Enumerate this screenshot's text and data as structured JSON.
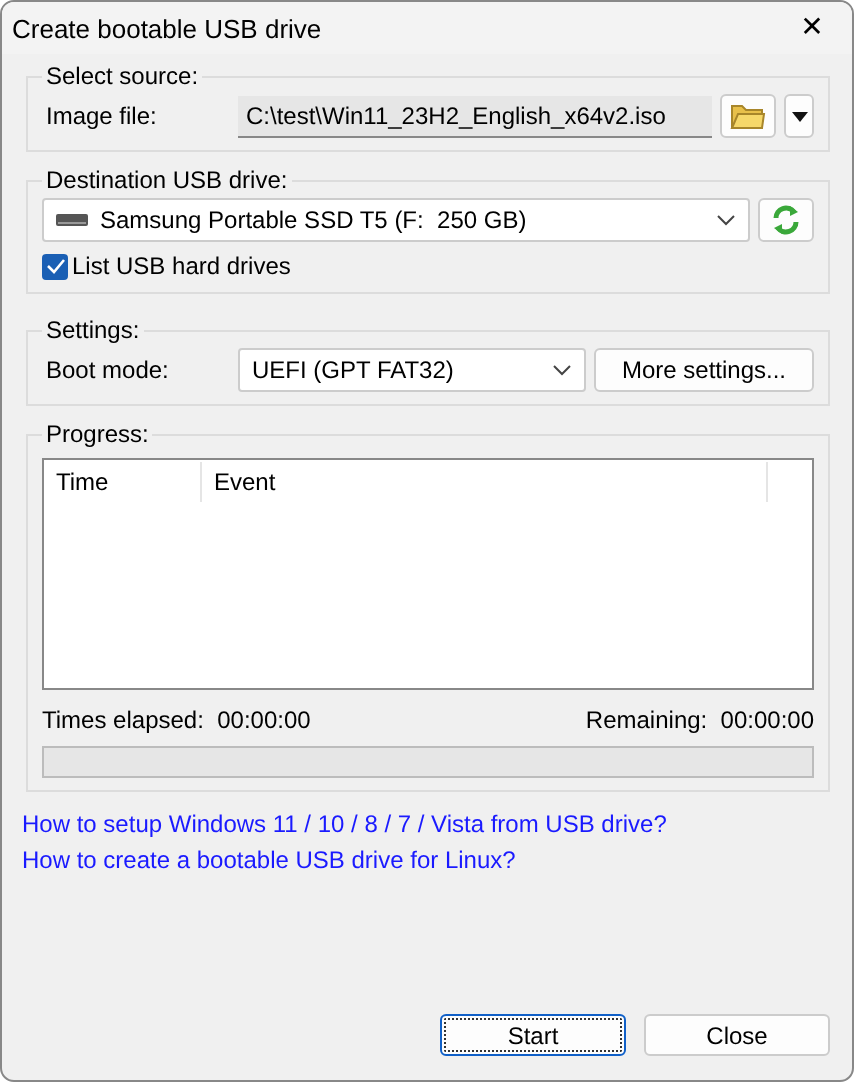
{
  "window": {
    "title": "Create bootable USB drive",
    "close": "✕"
  },
  "source": {
    "legend": "Select source:",
    "label": "Image file:",
    "value": "C:\\test\\Win11_23H2_English_x64v2.iso"
  },
  "destination": {
    "legend": "Destination USB drive:",
    "drive": "Samsung Portable SSD T5 (F:  250 GB)",
    "list_usb": {
      "label": "List USB hard drives",
      "checked": true
    }
  },
  "settings": {
    "legend": "Settings:",
    "label": "Boot mode:",
    "value": "UEFI (GPT FAT32)",
    "button": "More settings..."
  },
  "progress": {
    "legend": "Progress:",
    "columns": [
      "Time",
      "Event"
    ],
    "elapsed_label": "Times elapsed:",
    "elapsed": "00:00:00",
    "remaining_label": "Remaining:",
    "remaining": "00:00:00",
    "level": 0
  },
  "links": [
    "How to setup Windows 11 / 10 / 8 / 7 / Vista from USB drive?",
    "How to create a bootable USB drive for Linux?"
  ],
  "buttons": [
    {
      "label": "Start",
      "focused": true
    },
    {
      "label": "Close",
      "focused": false
    }
  ]
}
